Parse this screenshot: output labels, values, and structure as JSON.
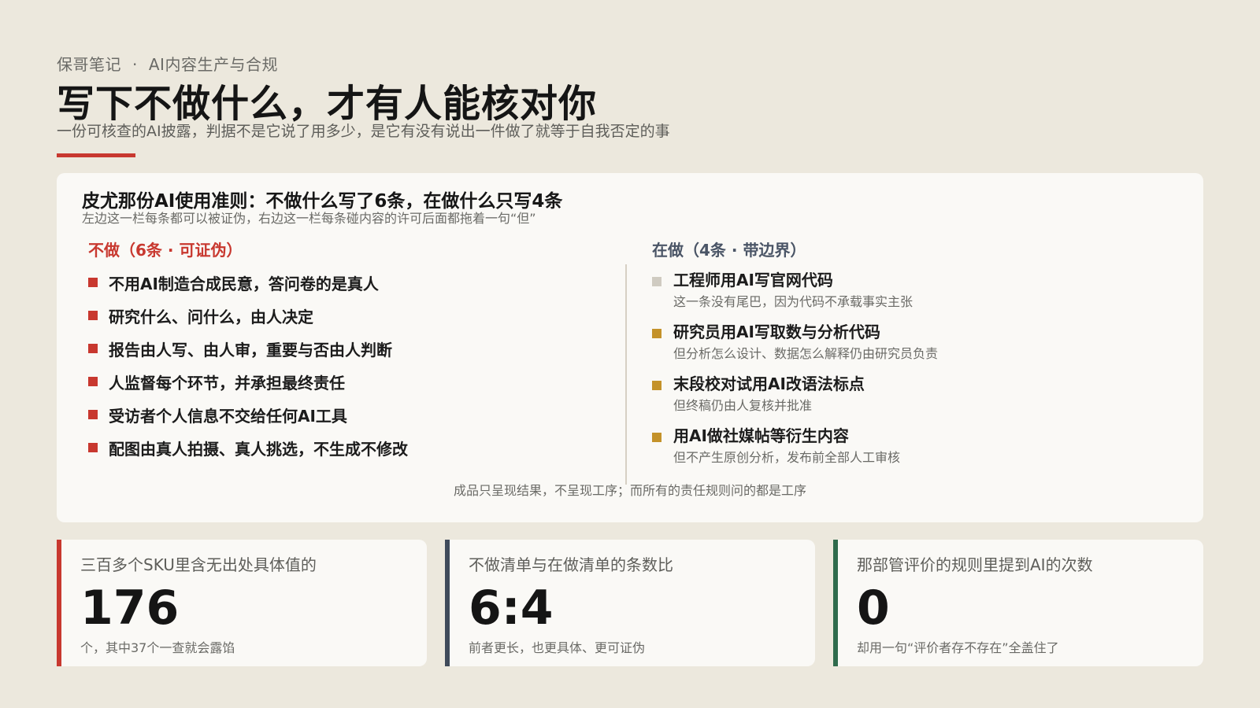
{
  "header": {
    "kicker_source": "保哥笔记",
    "kicker_sep": "·",
    "kicker_topic": "AI内容生产与合规",
    "title": "写下不做什么，才有人能核对你",
    "subtitle": "一份可核查的AI披露，判据不是它说了用多少，是它有没有说出一件做了就等于自我否定的事"
  },
  "main_card": {
    "title": "皮尤那份AI使用准则：不做什么写了6条，在做什么只写4条",
    "subtitle": "左边这一栏每条都可以被证伪，右边这一栏每条碰内容的许可后面都拖着一句“但”",
    "dont_heading": "不做（6条 · 可证伪）",
    "do_heading": "在做（4条 · 带边界）",
    "dont_items": [
      "不用AI制造合成民意，答问卷的是真人",
      "研究什么、问什么，由人决定",
      "报告由人写、由人审，重要与否由人判断",
      "人监督每个环节，并承担最终责任",
      "受访者个人信息不交给任何AI工具",
      "配图由真人拍摄、真人挑选，不生成不修改"
    ],
    "do_items": [
      {
        "main": "工程师用AI写官网代码",
        "sub": "这一条没有尾巴，因为代码不承载事实主张",
        "color": "#cfcbc1"
      },
      {
        "main": "研究员用AI写取数与分析代码",
        "sub": "但分析怎么设计、数据怎么解释仍由研究员负责",
        "color": "#c4922a"
      },
      {
        "main": "末段校对试用AI改语法标点",
        "sub": "但终稿仍由人复核并批准",
        "color": "#c4922a"
      },
      {
        "main": "用AI做社媒帖等衍生内容",
        "sub": "但不产生原创分析，发布前全部人工审核",
        "color": "#c4922a"
      }
    ],
    "footnote": "成品只呈现结果，不呈现工序；而所有的责任规则问的都是工序"
  },
  "stats": [
    {
      "label": "三百多个SKU里含无出处具体值的",
      "value": "176",
      "note": "个，其中37个一查就会露馅",
      "color": "#c8382f"
    },
    {
      "label": "不做清单与在做清单的条数比",
      "value": "6:4",
      "note": "前者更长，也更具体、更可证伪",
      "color": "#3f4a5a"
    },
    {
      "label": "那部管评价的规则里提到AI的次数",
      "value": "0",
      "note": "却用一句“评价者存不存在”全盖住了",
      "color": "#2f6b4c"
    }
  ]
}
